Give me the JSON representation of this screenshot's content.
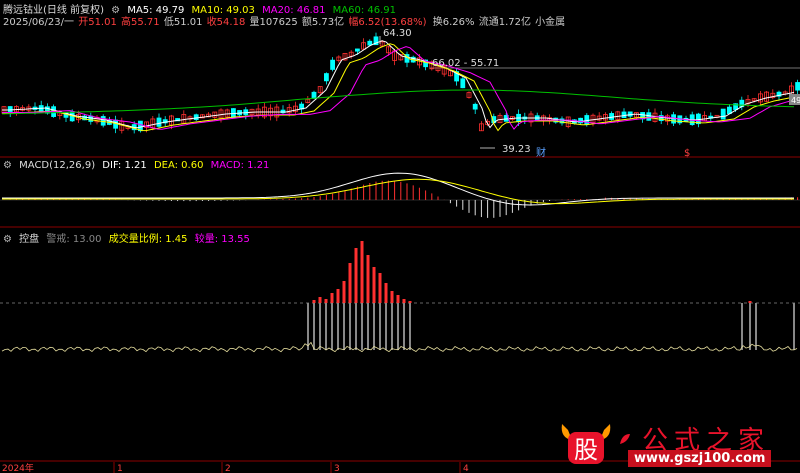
{
  "header": {
    "stock_title": "腾远钴业(日线 前复权)",
    "ma": [
      {
        "label": "MA5: 49.79",
        "color": "#ffffff"
      },
      {
        "label": "MA10: 49.03",
        "color": "#ffff00"
      },
      {
        "label": "MA20: 46.81",
        "color": "#ff00ff"
      },
      {
        "label": "MA60: 46.91",
        "color": "#00c000"
      }
    ],
    "info_items": [
      {
        "text": "2025/06/23/一",
        "color": "#cccccc"
      },
      {
        "text": "开51.01",
        "color": "#ff4040"
      },
      {
        "text": "高55.71",
        "color": "#ff4040"
      },
      {
        "text": "低51.01",
        "color": "#cccccc"
      },
      {
        "text": "收54.18",
        "color": "#ff4040"
      },
      {
        "text": "量107625",
        "color": "#cccccc"
      },
      {
        "text": "额5.73亿",
        "color": "#cccccc"
      },
      {
        "text": "幅6.52(13.68%)",
        "color": "#ff4040"
      },
      {
        "text": "换6.26%",
        "color": "#cccccc"
      },
      {
        "text": "流通1.72亿",
        "color": "#cccccc"
      },
      {
        "text": "小金属",
        "color": "#cccccc"
      }
    ]
  },
  "main_chart": {
    "annotations": {
      "high": "64.30",
      "range_label": "66.02 - 55.71",
      "low": "39.23",
      "right_price": "49"
    },
    "markers": [
      {
        "text": "财",
        "color": "#5aa0ff"
      },
      {
        "text": "$",
        "color": "#ff4040"
      }
    ]
  },
  "macd_panel": {
    "title": "MACD(12,26,9)",
    "dif": "DIF: 1.21",
    "dea": "DEA: 0.60",
    "macd": "MACD: 1.21",
    "colors": {
      "dif": "#ffffff",
      "dea": "#ffff00",
      "macd": "#ff00ff"
    }
  },
  "control_panel": {
    "title": "控盘",
    "warning": "警戒: 13.00",
    "ratio": "成交量比例: 1.45",
    "volume": "较量: 13.55",
    "colors": {
      "warning": "#888888",
      "ratio": "#ffff00",
      "volume": "#ff00ff"
    }
  },
  "time_axis": {
    "labels": [
      "2024年",
      "1",
      "2",
      "3",
      "4"
    ]
  },
  "watermark": {
    "logo_char": "股",
    "site_name": "公式之家",
    "url": "www.gszj100.com"
  },
  "colors": {
    "up": "#ff3030",
    "down": "#00ffff",
    "ma5": "#ffffff",
    "ma10": "#ffff00",
    "ma20": "#ff00ff",
    "ma60": "#00c000",
    "grid": "#8b0000"
  }
}
